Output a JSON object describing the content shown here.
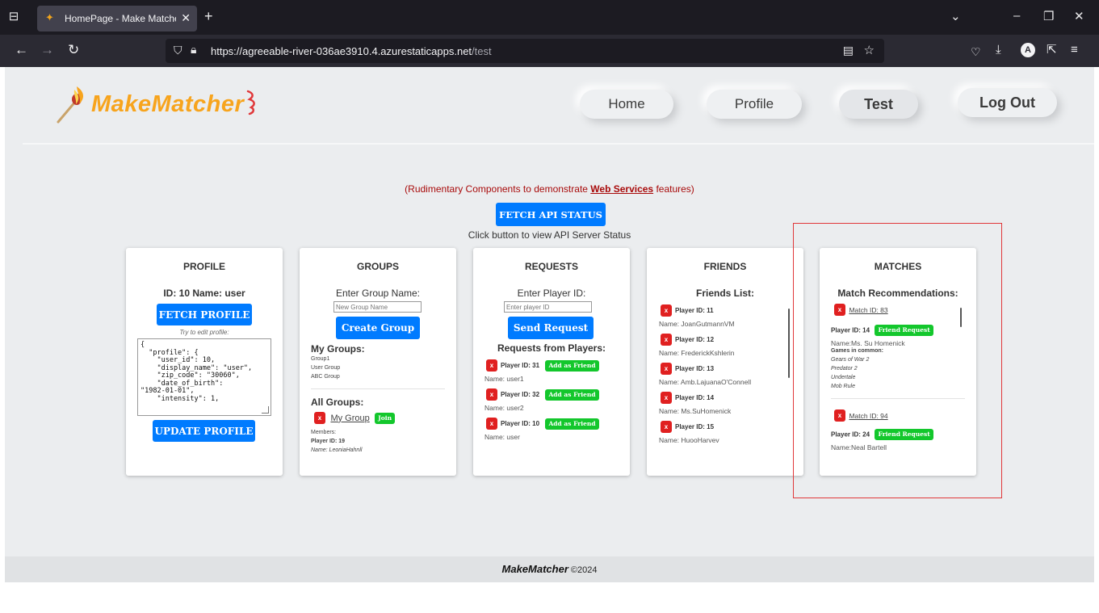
{
  "browser": {
    "tab_title": "HomePage - Make Matcher Tea",
    "url_host": "https://agreeable-river-036ae3910.4.azurestaticapps.net",
    "url_path": "/test"
  },
  "colors": {
    "primary": "#007bff",
    "success": "#13c72c",
    "danger": "#e02020",
    "logo": "#f7a41d",
    "notice": "#a80a0a",
    "highlight_border": "#e0383a"
  },
  "header": {
    "logo_text": "MakeMatcher",
    "nav": [
      {
        "label": "Home"
      },
      {
        "label": "Profile"
      },
      {
        "label": "Test"
      },
      {
        "label": "Log Out"
      }
    ]
  },
  "intro": {
    "notice_before": "(Rudimentary Components to demonstrate ",
    "notice_link": "Web Services",
    "notice_after": " features)",
    "fetch_api_label": "FETCH API STATUS",
    "api_hint": "Click button to view API Server Status"
  },
  "profile": {
    "title": "PROFILE",
    "id_line": "ID: 10 Name: user",
    "fetch_label": "FETCH PROFILE",
    "hint": "Try to edit profile:",
    "json_text": "{\n  \"profile\": {\n    \"user_id\": 10,\n    \"display_name\": \"user\",\n    \"zip_code\": \"30060\",\n    \"date_of_birth\":\n\"1982-01-01\",\n    \"intensity\": 1,",
    "update_label": "UPDATE PROFILE"
  },
  "groups": {
    "title": "GROUPS",
    "prompt": "Enter Group Name:",
    "placeholder": "New Group Name",
    "create_label": "Create Group",
    "my_groups_title": "My Groups:",
    "my_groups": [
      "Group1",
      "User Group",
      "ABC Group"
    ],
    "all_groups_title": "All Groups:",
    "all_group_name": "My Group",
    "join_label": "Join",
    "x_label": "x",
    "members_label": "Members:",
    "member_id": "Player ID: 19",
    "member_name": "Name: LeoniaHahnll"
  },
  "requests": {
    "title": "REQUESTS",
    "prompt": "Enter Player ID:",
    "placeholder": "Enter player ID",
    "send_label": "Send Request",
    "list_title": "Requests from Players:",
    "add_label": "Add as Friend",
    "x_label": "x",
    "items": [
      {
        "pid": "Player ID: 31",
        "name": "Name: user1"
      },
      {
        "pid": "Player ID: 32",
        "name": "Name: user2"
      },
      {
        "pid": "Player ID: 10",
        "name": "Name: user"
      }
    ]
  },
  "friends": {
    "title": "FRIENDS",
    "list_title": "Friends List:",
    "x_label": "x",
    "items": [
      {
        "pid": "Player ID: 11",
        "name": "Name: JoanGutmannVM"
      },
      {
        "pid": "Player ID: 12",
        "name": "Name: FrederickKshlerin"
      },
      {
        "pid": "Player ID: 13",
        "name": "Name: Amb.LajuanaO'Connell"
      },
      {
        "pid": "Player ID: 14",
        "name": "Name: Ms.SuHomenick"
      },
      {
        "pid": "Player ID: 15",
        "name": "Name: HuooHarvev"
      }
    ]
  },
  "matches": {
    "title": "MATCHES",
    "list_title": "Match Recommendations:",
    "x_label": "x",
    "friend_request_label": "Friend Request",
    "games_title": "Games in common:",
    "items": [
      {
        "match_id": "Match ID: 83",
        "pid": "Player ID: 14",
        "name": "Name:Ms. Su Homenick",
        "games": [
          "Gears of War 2",
          "Predator 2",
          "Undertale",
          "Mob Rule"
        ]
      },
      {
        "match_id": "Match ID: 94",
        "pid": "Player ID: 24",
        "name": "Name:Neal Bartell"
      }
    ]
  },
  "footer": {
    "brand": "MakeMatcher",
    "copy": "©2024"
  }
}
